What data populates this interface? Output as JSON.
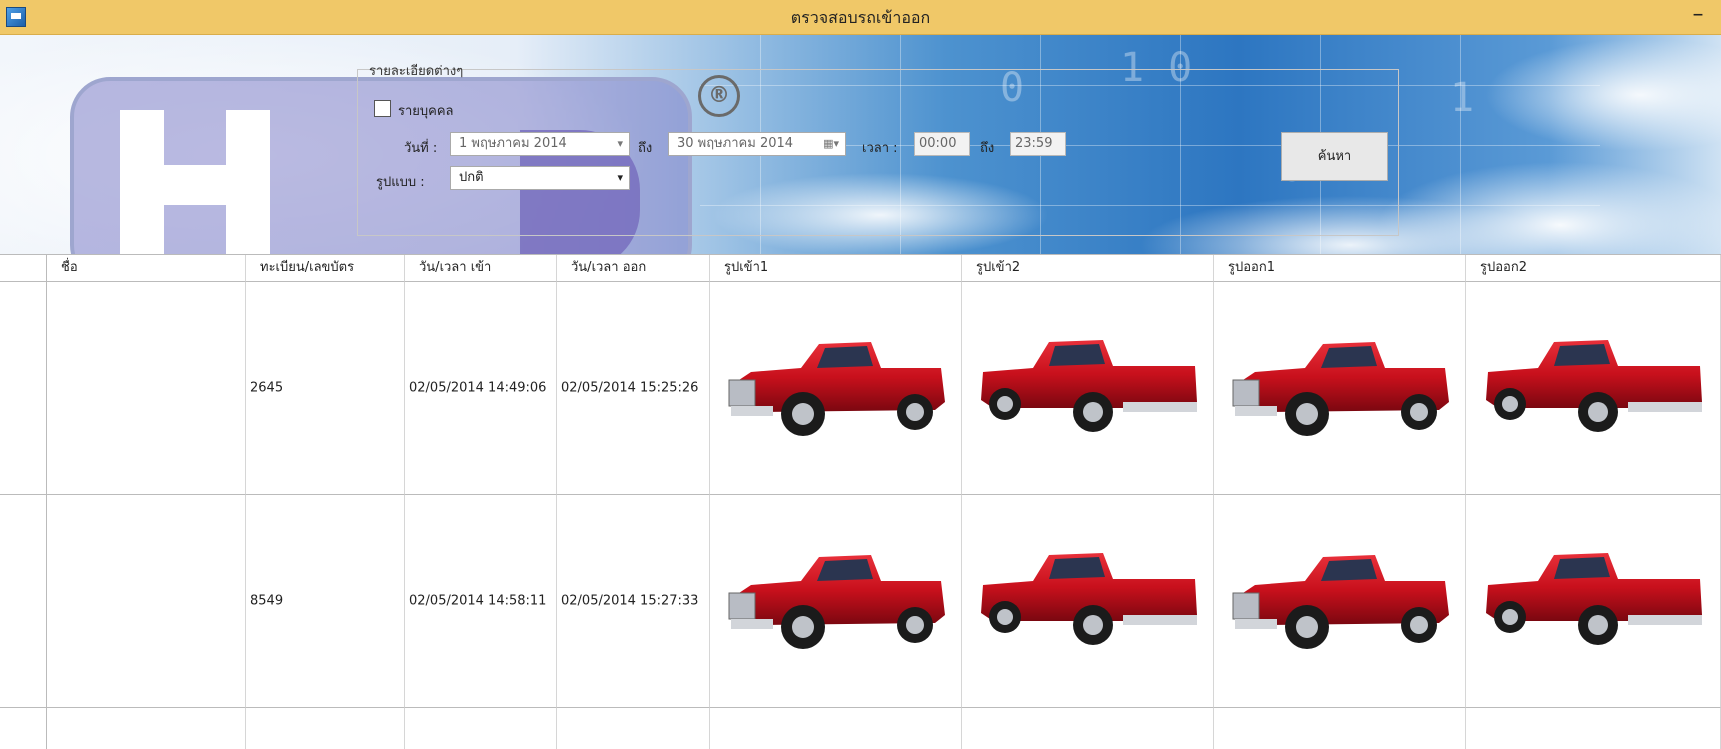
{
  "window": {
    "title": "ตรวจสอบรถเข้าออก",
    "minimize_glyph": "–",
    "icon": "app-icon"
  },
  "filter": {
    "group_title": "รายละเอียดต่างๆ",
    "person_checkbox_label": "รายบุคคล",
    "date_label": "วันที่ :",
    "date_from": "1  พฤษภาคม  2014",
    "to_label": "ถึง",
    "date_to": "30  พฤษภาคม  2014",
    "time_label": "เวลา :",
    "time_from": "00:00",
    "time_to": "23:59",
    "format_label": "รูปแบบ :",
    "format_value": "ปกติ",
    "search_button": "ค้นหา"
  },
  "header": {
    "registered_mark": "®"
  },
  "grid": {
    "columns": [
      "ชื่อ",
      "ทะเบียน/เลขบัตร",
      "วัน/เวลา เข้า",
      "วัน/เวลา ออก",
      "รูปเข้า1",
      "รูปเข้า2",
      "รูปออก1",
      "รูปออก2"
    ],
    "rows": [
      {
        "name": "",
        "plate": "2645",
        "time_in": "02/05/2014  14:49:06",
        "time_out": "02/05/2014  15:25:26"
      },
      {
        "name": "",
        "plate": "8549",
        "time_in": "02/05/2014  14:58:11",
        "time_out": "02/05/2014  15:27:33"
      }
    ]
  },
  "colors": {
    "title_bar": "#f0c868",
    "truck_red": "#c8101c"
  }
}
